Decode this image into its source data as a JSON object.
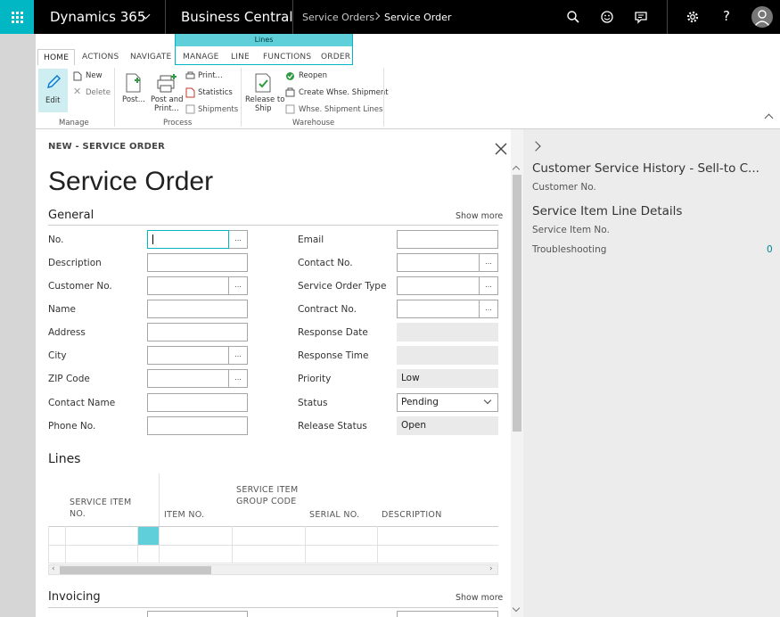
{
  "topbar": {
    "brand": "Dynamics 365",
    "app": "Business Central",
    "breadcrumb": [
      "Service Orders",
      "Service Order"
    ]
  },
  "ribbon": {
    "tabs": [
      "HOME",
      "ACTIONS",
      "NAVIGATE",
      "MANAGE",
      "LINE",
      "FUNCTIONS",
      "ORDER"
    ],
    "context_group": "Lines",
    "groups": {
      "manage": {
        "label": "Manage",
        "edit": "Edit",
        "new": "New",
        "delete": "Delete"
      },
      "process": {
        "label": "Process",
        "post": "Post...",
        "post_print_1": "Post and",
        "post_print_2": "Print...",
        "print": "Print...",
        "statistics": "Statistics",
        "shipments": "Shipments"
      },
      "warehouse": {
        "label": "Warehouse",
        "release_1": "Release to",
        "release_2": "Ship",
        "reopen": "Reopen",
        "create_whse": "Create Whse. Shipment",
        "whse_lines": "Whse. Shipment Lines"
      }
    }
  },
  "card": {
    "caption": "NEW - SERVICE ORDER",
    "title": "Service Order",
    "general": {
      "heading": "General",
      "show_more": "Show more",
      "left_fields": [
        {
          "label": "No.",
          "value": ""
        },
        {
          "label": "Description",
          "value": ""
        },
        {
          "label": "Customer No.",
          "value": ""
        },
        {
          "label": "Name",
          "value": ""
        },
        {
          "label": "Address",
          "value": ""
        },
        {
          "label": "City",
          "value": ""
        },
        {
          "label": "ZIP Code",
          "value": ""
        },
        {
          "label": "Contact Name",
          "value": ""
        },
        {
          "label": "Phone No.",
          "value": ""
        }
      ],
      "right_fields": [
        {
          "label": "Email",
          "value": ""
        },
        {
          "label": "Contact No.",
          "value": ""
        },
        {
          "label": "Service Order Type",
          "value": ""
        },
        {
          "label": "Contract No.",
          "value": ""
        },
        {
          "label": "Response Date",
          "value": ""
        },
        {
          "label": "Response Time",
          "value": ""
        },
        {
          "label": "Priority",
          "value": "Low"
        },
        {
          "label": "Status",
          "value": "Pending"
        },
        {
          "label": "Release Status",
          "value": "Open"
        }
      ]
    },
    "lines": {
      "heading": "Lines",
      "columns": [
        "SERVICE ITEM NO.",
        "ITEM NO.",
        "SERVICE ITEM GROUP CODE",
        "SERIAL NO.",
        "DESCRIPTION"
      ]
    },
    "invoicing": {
      "heading": "Invoicing",
      "show_more": "Show more"
    }
  },
  "factbox": {
    "part1_title": "Customer Service History - Sell-to C...",
    "part1_field": "Customer No.",
    "part2_title": "Service Item Line Details",
    "part2_field": "Service Item No.",
    "troubleshooting_label": "Troubleshooting",
    "troubleshooting_value": "0"
  },
  "colors": {
    "accent": "#00b7c3",
    "topbar": "#000000"
  }
}
